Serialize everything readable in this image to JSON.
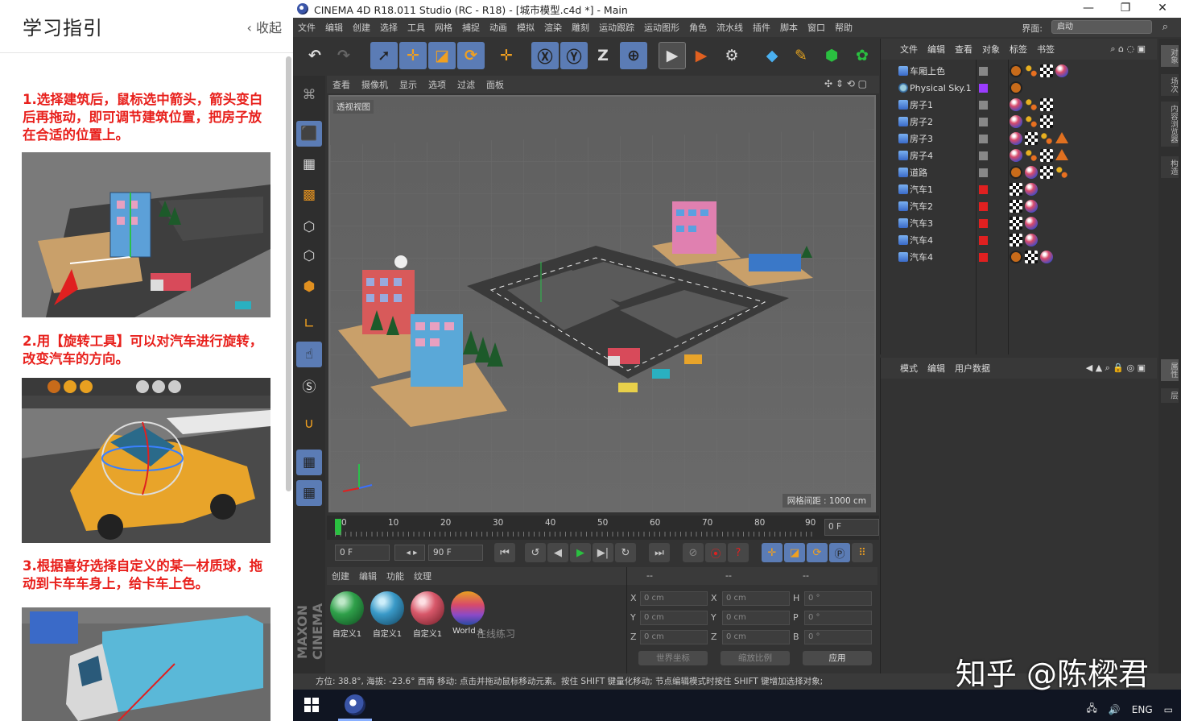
{
  "guide": {
    "title": "学习指引",
    "collapse": "收起",
    "steps": [
      "1.选择建筑后，鼠标选中箭头，箭头变白后再拖动，即可调节建筑位置，把房子放在合适的位置上。",
      "2.用【旋转工具】可以对汽车进行旋转，改变汽车的方向。",
      "3.根据喜好选择自定义的某一材质球，拖动到卡车车身上，给卡车上色。"
    ]
  },
  "window": {
    "title": "CINEMA 4D R18.011 Studio (RC - R18) - [城市模型.c4d *] - Main",
    "minimize": "—",
    "maximize": "❐",
    "close": "✕"
  },
  "menu": {
    "items": [
      "文件",
      "编辑",
      "创建",
      "选择",
      "工具",
      "网格",
      "捕捉",
      "动画",
      "模拟",
      "渲染",
      "雕刻",
      "运动跟踪",
      "运动图形",
      "角色",
      "流水线",
      "插件",
      "脚本",
      "窗口",
      "帮助"
    ],
    "layout_label": "界面:",
    "layout_value": "启动"
  },
  "viewport": {
    "menu": [
      "查看",
      "摄像机",
      "显示",
      "选项",
      "过滤",
      "面板"
    ],
    "label": "透视视图",
    "grid_spacing": "网格间距 : 1000 cm"
  },
  "timeline": {
    "ticks": [
      "0",
      "10",
      "20",
      "30",
      "40",
      "50",
      "60",
      "70",
      "80",
      "90"
    ],
    "current_frame": "0 F",
    "start_field": "0 F",
    "end_field": "90 F"
  },
  "materials": {
    "menu": [
      "创建",
      "编辑",
      "功能",
      "纹理"
    ],
    "items": [
      {
        "name": "自定义1",
        "color": "#2fa04a"
      },
      {
        "name": "自定义1",
        "color": "#3a9ac8"
      },
      {
        "name": "自定义1",
        "color": "#d8586a"
      },
      {
        "name": "World a",
        "color": "#8a4ac8"
      }
    ],
    "overlay_text": "在线练习"
  },
  "coords": {
    "header": [
      "--",
      "--",
      "--"
    ],
    "rows": [
      {
        "a": "X",
        "av": "0 cm",
        "b": "X",
        "bv": "0 cm",
        "c": "H",
        "cv": "0 °"
      },
      {
        "a": "Y",
        "av": "0 cm",
        "b": "Y",
        "bv": "0 cm",
        "c": "P",
        "cv": "0 °"
      },
      {
        "a": "Z",
        "av": "0 cm",
        "b": "Z",
        "bv": "0 cm",
        "c": "B",
        "cv": "0 °"
      }
    ],
    "world": "世界坐标",
    "scale": "缩放比例",
    "apply": "应用"
  },
  "status": "方位: 38.8°, 海拔: -23.6° 西南      移动: 点击并拖动鼠标移动元素。按住 SHIFT 键量化移动; 节点编辑模式时按住 SHIFT 键增加选择对象;",
  "objects": {
    "menu": [
      "文件",
      "编辑",
      "查看",
      "对象",
      "标签",
      "书签"
    ],
    "rows": [
      {
        "name": "车厢上色",
        "flag": "#888"
      },
      {
        "name": "Physical Sky.1",
        "flag": "#9b3cff"
      },
      {
        "name": "房子1",
        "flag": "#888"
      },
      {
        "name": "房子2",
        "flag": "#888"
      },
      {
        "name": "房子3",
        "flag": "#888"
      },
      {
        "name": "房子4",
        "flag": "#888"
      },
      {
        "name": "道路",
        "flag": "#888"
      },
      {
        "name": "汽车1",
        "flag": "#e02020"
      },
      {
        "name": "汽车2",
        "flag": "#e02020"
      },
      {
        "name": "汽车3",
        "flag": "#e02020"
      },
      {
        "name": "汽车4",
        "flag": "#e02020"
      },
      {
        "name": "汽车4",
        "flag": "#e02020"
      }
    ]
  },
  "attributes": {
    "menu": [
      "模式",
      "编辑",
      "用户数据"
    ]
  },
  "right_tabs": [
    "对象",
    "场次",
    "内容浏览器",
    "构造",
    "属性",
    "层"
  ],
  "watermark": "知乎 @陈樑君",
  "tray": {
    "lang": "ENG"
  },
  "brand": "MAXON CINEMA 4D"
}
